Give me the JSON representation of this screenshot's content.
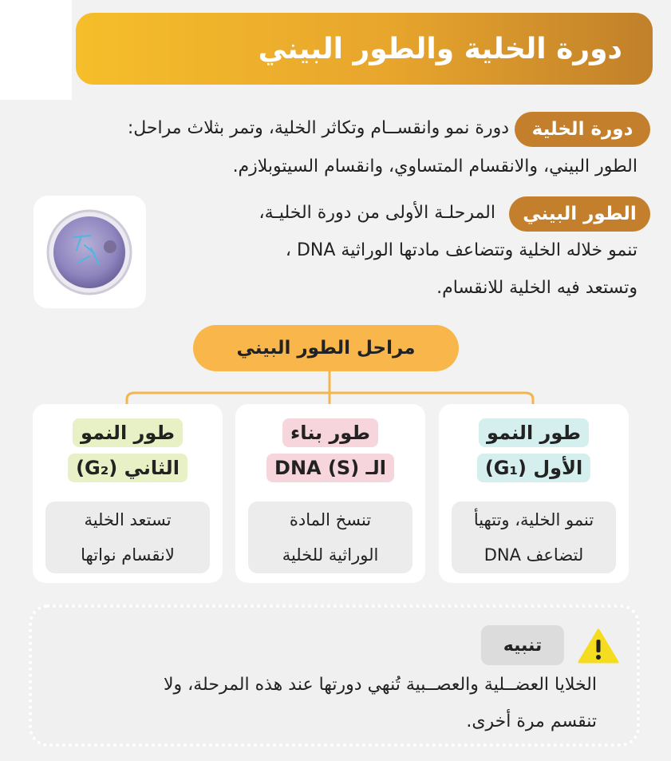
{
  "title": "دورة الخلية والطور البيني",
  "cell_cycle": {
    "term": "دورة الخلية",
    "line1": "دورة نمو وانقســام وتكاثر الخلية، وتمر بثلاث مراحل:",
    "line2": "الطور البيني، والانقسام المتساوي، وانقسام السيتوبلازم."
  },
  "interphase": {
    "term": "الطور البيني",
    "line1": "المرحلـة الأولى من دورة الخليـة،",
    "line2": "تنمو خلاله الخلية وتتضاعف مادتها الوراثية DNA ،",
    "line3": "وتستعد فيه الخلية للانقسام."
  },
  "stages_title": "مراحل الطور البيني",
  "phases": [
    {
      "label_line1": "طور النمو",
      "label_line2": "الأول (G₁)",
      "desc_line1": "تنمو الخلية، وتتهيأ",
      "desc_line2": "لتضاعف DNA",
      "label_color": "#d5eeee"
    },
    {
      "label_line1": "طور بناء",
      "label_line2": "الـ DNA (S)",
      "desc_line1": "تنسخ المادة",
      "desc_line2": "الوراثية للخلية",
      "label_color": "#f7d5dc"
    },
    {
      "label_line1": "طور النمو",
      "label_line2": "الثاني (G₂)",
      "desc_line1": "تستعد الخلية",
      "desc_line2": "لانقسام نواتها",
      "label_color": "#e8f0c5"
    }
  ],
  "note": {
    "label": "تنبيه",
    "icon": "warning-icon",
    "line1": "الخلايا العضــلية والعصــبية تُنهي دورتها عند هذه المرحلة، ولا",
    "line2": "تنقسم مرة أخرى."
  },
  "colors": {
    "banner_start": "#f6be2a",
    "banner_end": "#c1802a",
    "term_pill": "#c37f2c",
    "stages_pill": "#f9b64a",
    "connector": "#f3b54e",
    "warning": "#f5dc1e"
  }
}
